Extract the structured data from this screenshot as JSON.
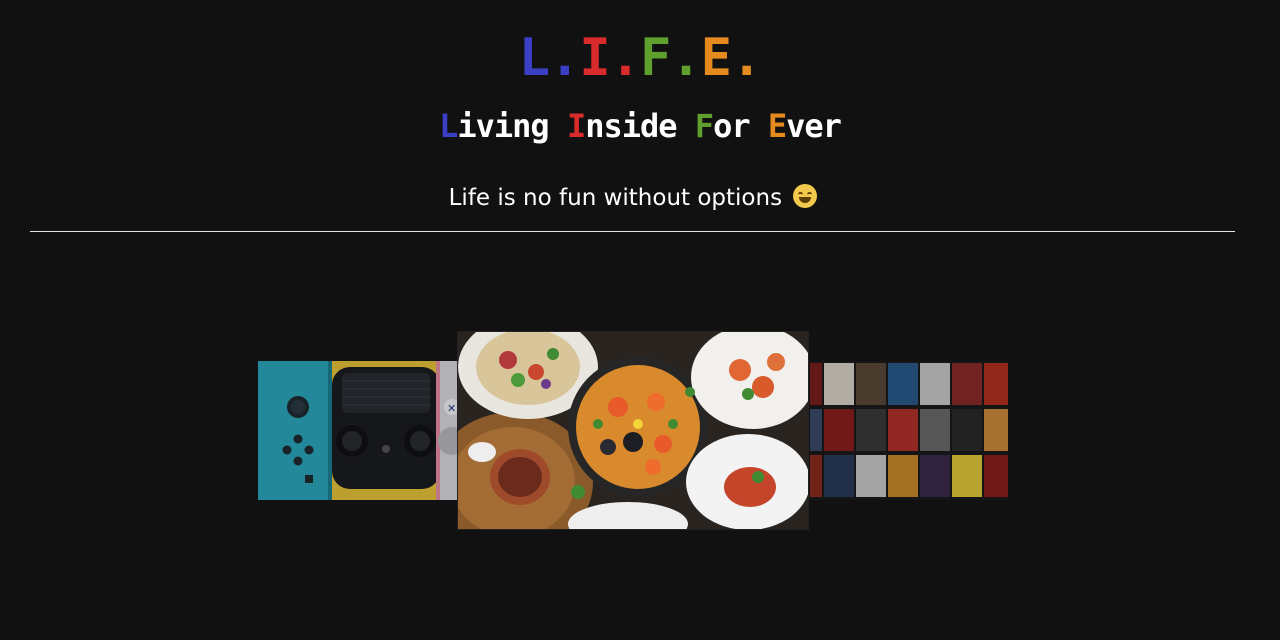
{
  "header": {
    "logo_letters": [
      {
        "char": "L",
        "color": "#3a3fc4"
      },
      {
        "char": ".",
        "color": "#3a3fc4"
      },
      {
        "char": "I",
        "color": "#d92b2b"
      },
      {
        "char": ".",
        "color": "#d92b2b"
      },
      {
        "char": "F",
        "color": "#5fa02e"
      },
      {
        "char": ".",
        "color": "#5fa02e"
      },
      {
        "char": "E",
        "color": "#e58a1f"
      },
      {
        "char": ".",
        "color": "#e58a1f"
      }
    ],
    "tagline_words": [
      {
        "initial": "L",
        "rest": "iving",
        "color": "#3a3fc4"
      },
      {
        "initial": "I",
        "rest": "nside",
        "color": "#d92b2b"
      },
      {
        "initial": "F",
        "rest": "or",
        "color": "#5fa02e"
      },
      {
        "initial": "E",
        "rest": "ver",
        "color": "#e58a1f"
      }
    ],
    "subtitle": "Life is no fun without options",
    "subtitle_emoji": "grinning-face-icon"
  },
  "carousel": {
    "items": [
      {
        "name": "games",
        "image": "game-controllers-photo"
      },
      {
        "name": "food",
        "image": "food-platter-photo",
        "active": true
      },
      {
        "name": "movies",
        "image": "movie-covers-collage"
      }
    ]
  },
  "colors": {
    "background": "#111111",
    "text": "#ffffff",
    "divider": "#e5e5e5"
  }
}
